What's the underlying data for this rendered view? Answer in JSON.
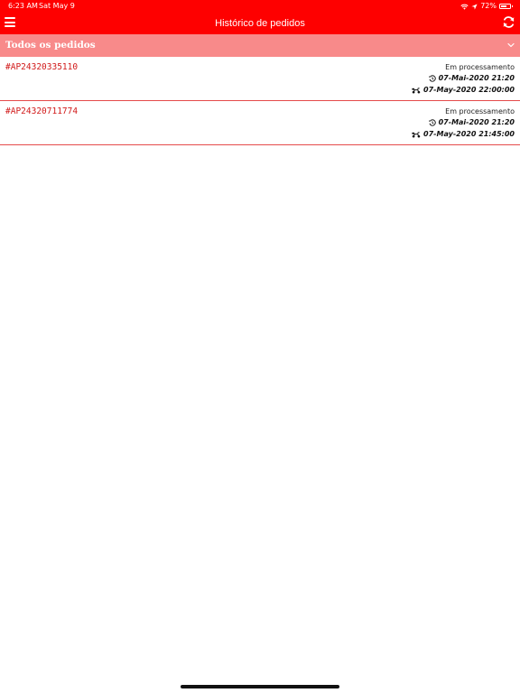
{
  "status_bar": {
    "time": "6:23 AM",
    "date": "Sat May 9",
    "battery_percent": "72%",
    "battery_level": 0.72,
    "icons": [
      "wifi-icon",
      "location-icon",
      "battery-icon"
    ]
  },
  "header": {
    "title": "Histórico de pedidos",
    "menu_icon": "hamburger-menu-icon",
    "refresh_icon": "refresh-icon"
  },
  "filter": {
    "selected": "Todos os pedidos",
    "icon": "chevron-down-icon"
  },
  "orders": [
    {
      "id": "#AP24320335110",
      "status": "Em processamento",
      "order_time": "07-Mai-2020 21:20",
      "delivery_time": "07-May-2020 22:00:00"
    },
    {
      "id": "#AP24320711774",
      "status": "Em processamento",
      "order_time": "07-Mai-2020 21:20",
      "delivery_time": "07-May-2020 21:45:00"
    }
  ],
  "colors": {
    "primary": "#fe0000",
    "filter_bar": "#f88a8a",
    "order_id": "#d11a1a",
    "divider": "#e54b4b"
  }
}
